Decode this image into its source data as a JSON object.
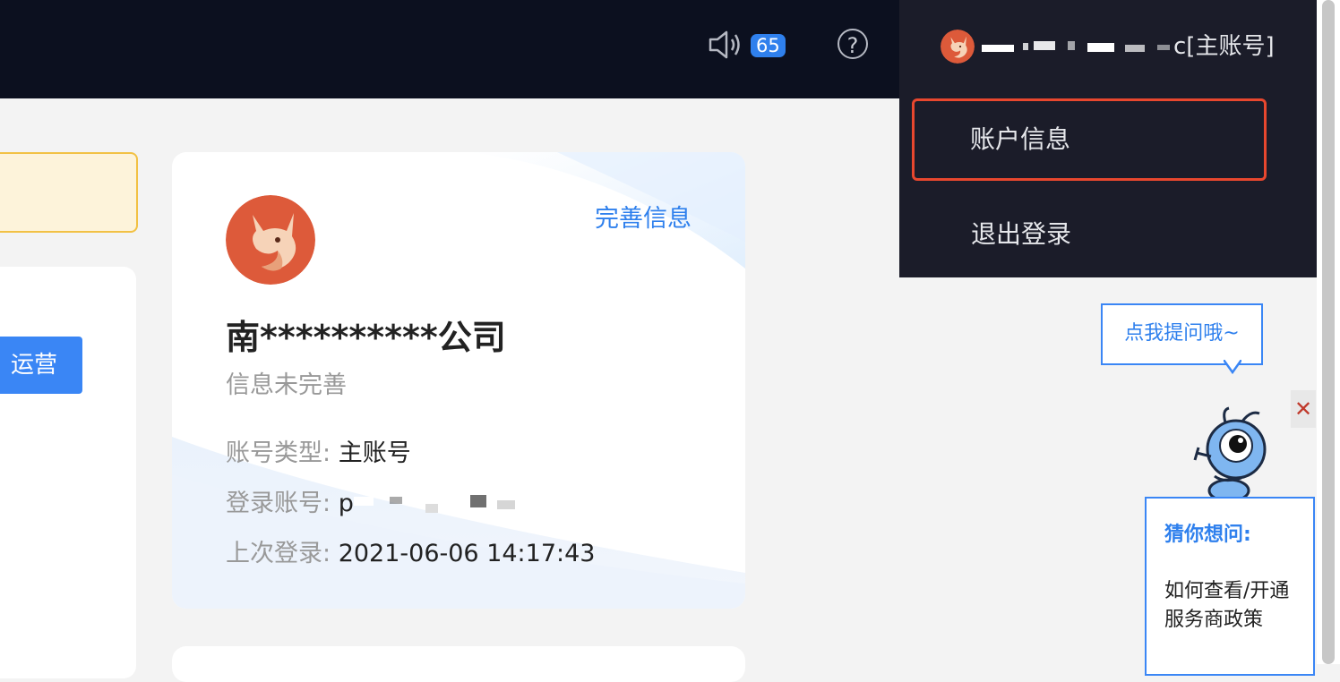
{
  "header": {
    "notification_count": "65",
    "help_symbol": "?",
    "user_label": "c[主账号]",
    "menu": {
      "account_info": "账户信息",
      "logout": "退出登录"
    },
    "icons": {
      "speaker": "speaker-icon",
      "help": "help-icon",
      "avatar": "fox-avatar"
    },
    "colors": {
      "topbar": "#0c101f",
      "panel": "#1b1c29",
      "highlight": "#e8472e",
      "badge": "#2f80ed"
    }
  },
  "left": {
    "button_label": "运营"
  },
  "profile_card": {
    "complete_link": "完善信息",
    "company_name": "南**********公司",
    "status": "信息未完善",
    "account_type_label": "账号类型:",
    "account_type_value": "主账号",
    "login_account_label": "登录账号:",
    "login_account_value": "p",
    "last_login_label": "上次登录:",
    "last_login_value": "2021-06-06 14:17:43"
  },
  "assistant": {
    "bubble": "点我提问哦~",
    "close": "✕",
    "guess_title": "猜你想问:",
    "guess_question": "如何查看/开通服务商政策"
  }
}
